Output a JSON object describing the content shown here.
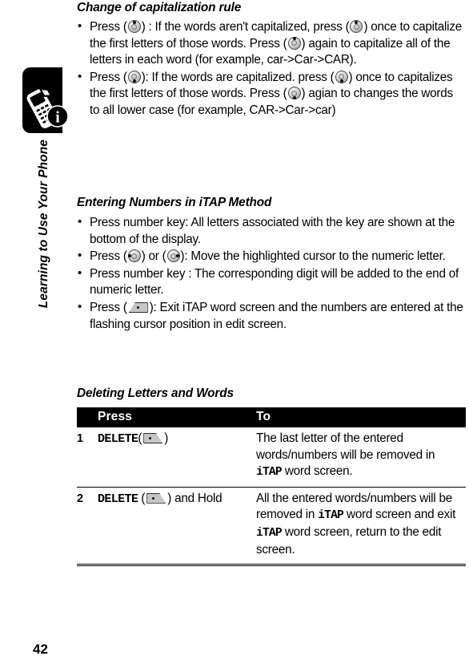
{
  "sidebar": {
    "chapter_title": "Learning to Use Your Phone",
    "tab_icon": "phone-info-icon",
    "page_number": "42"
  },
  "main": {
    "headings": {
      "capitalization": "Change of capitalization rule",
      "entering_numbers": "Entering Numbers in iTAP Method",
      "deleting": "Deleting Letters and Words"
    },
    "capitalization_bullets": [
      {
        "parts": [
          {
            "t": "text",
            "v": "Press ("
          },
          {
            "t": "icon",
            "v": "nav-key-up-icon"
          },
          {
            "t": "text",
            "v": ") : If the words aren't capitalized, press ("
          },
          {
            "t": "icon",
            "v": "nav-key-up-icon"
          },
          {
            "t": "text",
            "v": ") once to capitalize the first letters of those words. Press ("
          },
          {
            "t": "icon",
            "v": "nav-key-up-icon"
          },
          {
            "t": "text",
            "v": ") again to capitalize all of the letters in each word (for example, car->Car->CAR)."
          }
        ]
      },
      {
        "parts": [
          {
            "t": "text",
            "v": "Press ("
          },
          {
            "t": "icon",
            "v": "nav-key-down-icon"
          },
          {
            "t": "text",
            "v": "): If the words are capitalized. press ("
          },
          {
            "t": "icon",
            "v": "nav-key-down-icon"
          },
          {
            "t": "text",
            "v": ") once to capitalizes the first letters of those words. Press ("
          },
          {
            "t": "icon",
            "v": "nav-key-down-icon"
          },
          {
            "t": "text",
            "v": ") agian to changes the words to all lower case (for example, CAR->Car->car)"
          }
        ]
      }
    ],
    "entering_bullets": [
      {
        "parts": [
          {
            "t": "text",
            "v": "Press number key: All letters associated with the key are shown at the bottom of the display."
          }
        ]
      },
      {
        "parts": [
          {
            "t": "text",
            "v": "Press ("
          },
          {
            "t": "icon",
            "v": "nav-key-left-icon"
          },
          {
            "t": "text",
            "v": ") or ("
          },
          {
            "t": "icon",
            "v": "nav-key-right-icon"
          },
          {
            "t": "text",
            "v": "): Move the highlighted cursor to the numeric letter."
          }
        ]
      },
      {
        "parts": [
          {
            "t": "text",
            "v": "Press number key : The corresponding digit will be added to the end of numeric letter."
          }
        ]
      },
      {
        "parts": [
          {
            "t": "text",
            "v": "Press ("
          },
          {
            "t": "icon",
            "v": "right-soft-key-icon"
          },
          {
            "t": "text",
            "v": "): Exit iTAP word screen and the numbers are entered at the flashing cursor position in edit screen."
          }
        ]
      }
    ]
  },
  "table": {
    "headers": {
      "num": "",
      "press": "Press",
      "to": "To"
    },
    "rows": [
      {
        "num": "1",
        "press_parts": [
          {
            "t": "mono",
            "v": "DELETE"
          },
          {
            "t": "text",
            "v": "("
          },
          {
            "t": "icon",
            "v": "left-soft-key-icon"
          },
          {
            "t": "text",
            "v": ")"
          }
        ],
        "to_parts": [
          {
            "t": "text",
            "v": "The last letter of the entered words/numbers will be removed in "
          },
          {
            "t": "itap",
            "v": "iTAP"
          },
          {
            "t": "text",
            "v": " word screen."
          }
        ]
      },
      {
        "num": "2",
        "press_parts": [
          {
            "t": "mono",
            "v": "DELETE"
          },
          {
            "t": "text",
            "v": " ("
          },
          {
            "t": "icon",
            "v": "left-soft-key-icon"
          },
          {
            "t": "text",
            "v": ") and Hold"
          }
        ],
        "to_parts": [
          {
            "t": "text",
            "v": "All the entered words/numbers will be removed in "
          },
          {
            "t": "itap",
            "v": "iTAP"
          },
          {
            "t": "text",
            "v": " word screen and exit "
          },
          {
            "t": "itap",
            "v": "iTAP"
          },
          {
            "t": "text",
            "v": " word screen, return to the edit screen."
          }
        ]
      }
    ]
  },
  "colors": {
    "ink": "#000000",
    "paper": "#ffffff",
    "key_face": "#c6c6c6"
  }
}
